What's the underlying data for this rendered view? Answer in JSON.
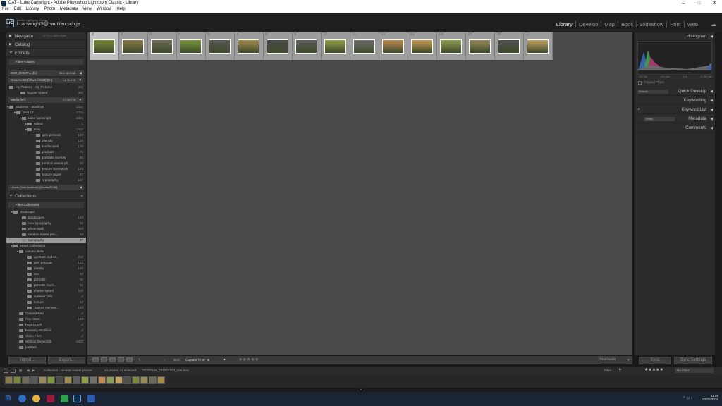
{
  "window": {
    "title": "CAT - Luke Cartwright - Adobe Photoshop Lightroom Classic - Library"
  },
  "menu": [
    "File",
    "Edit",
    "Library",
    "Photo",
    "Metadata",
    "View",
    "Window",
    "Help"
  ],
  "identity": {
    "app": "Adobe Lightroom Classic",
    "user": "l.cartwright5@hautlieu.sch.je"
  },
  "modules": [
    "Library",
    "Develop",
    "Map",
    "Book",
    "Slideshow",
    "Print",
    "Web"
  ],
  "active_module": "Library",
  "left": {
    "navigator": {
      "label": "Navigator",
      "opts": "FIT  FILL  100%  300%"
    },
    "catalog": "Catalog",
    "folders": "Folders",
    "filter_folders": "Filter Folders",
    "volumes": [
      {
        "name": "EOS_DIGITAL (E:)",
        "info": "80.1 / 60.0 GB"
      },
      {
        "name": "Documents (\\\\fsvs1\\\\Sd$) (H:)",
        "info": "0.6 / 1.6 TB"
      }
    ],
    "folders_a": [
      {
        "name": "My Pictures - My Pictures",
        "count": "465",
        "indent": 4
      },
      {
        "name": "Shutter Speed",
        "count": "465",
        "indent": 20
      }
    ],
    "volume3": {
      "name": "Media (M:)",
      "info": "0.7 / 3.6 TB"
    },
    "folders_b": [
      {
        "name": "Students - Students",
        "count": "1334",
        "indent": 4,
        "tri": "▾"
      },
      {
        "name": "Year 12",
        "count": "1334",
        "indent": 14,
        "tri": "▾"
      },
      {
        "name": "Luke Cartwright",
        "count": "1334",
        "indent": 22,
        "tri": "▾"
      },
      {
        "name": "edited",
        "count": "1",
        "indent": 30,
        "tri": "▸"
      },
      {
        "name": "Raw",
        "count": "1333",
        "indent": 30,
        "tri": "▾"
      },
      {
        "name": "gels portraits",
        "count": "123",
        "indent": 42,
        "tri": ""
      },
      {
        "name": "identity",
        "count": "128",
        "indent": 42,
        "tri": ""
      },
      {
        "name": "landscapes",
        "count": "176",
        "indent": 42,
        "tri": ""
      },
      {
        "name": "portraits",
        "count": "76",
        "indent": 42,
        "tri": ""
      },
      {
        "name": "portraits low-key",
        "count": "85",
        "indent": 42,
        "tri": ""
      },
      {
        "name": "random easter ph...",
        "count": "34",
        "indent": 42,
        "tri": ""
      },
      {
        "name": "texture homework",
        "count": "124",
        "indent": 42,
        "tri": ""
      },
      {
        "name": "texture paper",
        "count": "87",
        "indent": 42,
        "tri": ""
      },
      {
        "name": "typography",
        "count": "107",
        "indent": 42,
        "tri": ""
      }
    ],
    "volume4": "Ubuntu (\\\\wsl.localhost) (Ubuntu-22.04)",
    "collections": "Collections",
    "filter_collections": "Filter Collections",
    "coll": [
      {
        "name": "landscape",
        "count": "",
        "indent": 10,
        "tri": "▾"
      },
      {
        "name": "landscapes",
        "count": "124",
        "indent": 22,
        "tri": ""
      },
      {
        "name": "new typography",
        "count": "98",
        "indent": 22,
        "tri": ""
      },
      {
        "name": "photo walk",
        "count": "463",
        "indent": 22,
        "tri": ""
      },
      {
        "name": "random easter pho...",
        "count": "34",
        "indent": 22,
        "tri": ""
      },
      {
        "name": "typography",
        "count": "37",
        "indent": 22,
        "tri": "",
        "sel": true
      },
      {
        "name": "Smart Collections",
        "count": "",
        "indent": 10,
        "tri": "▾"
      },
      {
        "name": "comms skills",
        "count": "",
        "indent": 18,
        "tri": "▾"
      },
      {
        "name": "aperture and D...",
        "count": "228",
        "indent": 30,
        "tri": ""
      },
      {
        "name": "gels portraits",
        "count": "123",
        "indent": 30,
        "tri": ""
      },
      {
        "name": "identity",
        "count": "128",
        "indent": 30,
        "tri": ""
      },
      {
        "name": "ISO",
        "count": "44",
        "indent": 30,
        "tri": ""
      },
      {
        "name": "portraits",
        "count": "75",
        "indent": 30,
        "tri": ""
      },
      {
        "name": "portraits low-k...",
        "count": "85",
        "indent": 30,
        "tri": ""
      },
      {
        "name": "shutter speed",
        "count": "119",
        "indent": 30,
        "tri": ""
      },
      {
        "name": "summer task",
        "count": "0",
        "indent": 30,
        "tri": ""
      },
      {
        "name": "texture",
        "count": "64",
        "indent": 30,
        "tri": ""
      },
      {
        "name": "Texture Homew...",
        "count": "124",
        "indent": 30,
        "tri": ""
      },
      {
        "name": "Colored Red",
        "count": "0",
        "indent": 18,
        "tri": ""
      },
      {
        "name": "Five Stars",
        "count": "123",
        "indent": 18,
        "tri": ""
      },
      {
        "name": "Past Month",
        "count": "0",
        "indent": 18,
        "tri": ""
      },
      {
        "name": "Recently Modified",
        "count": "0",
        "indent": 18,
        "tri": ""
      },
      {
        "name": "Video Files",
        "count": "0",
        "indent": 18,
        "tri": ""
      },
      {
        "name": "Without Keywords",
        "count": "1603",
        "indent": 18,
        "tri": ""
      },
      {
        "name": "portraits",
        "count": "",
        "indent": 18,
        "tri": ""
      }
    ],
    "import": "Import...",
    "export": "Export..."
  },
  "grid": {
    "numbers": [
      "1",
      "2",
      "3",
      "4",
      "5",
      "6",
      "7",
      "8",
      "9",
      "10",
      "11",
      "12",
      "13",
      "14",
      "15",
      "16",
      "17"
    ],
    "colors": [
      "#7a8a3a",
      "#8c7b4a",
      "#6e6b55",
      "#7c9a3e",
      "#585858",
      "#a48a4c",
      "#4a4a4a",
      "#5e5e5e",
      "#93a04a",
      "#707070",
      "#c08a50",
      "#c89a52",
      "#8aa050",
      "#9a8a5a",
      "#4f4f4f",
      "#c4a460"
    ]
  },
  "toolbar": {
    "sort_label": "Sort:",
    "sort_value": "Capture Time",
    "stars": "★★★★★",
    "thumbnails": "Thumbnails"
  },
  "right": {
    "histogram": "Histogram",
    "hist_values": [
      "ISO 100",
      "4.00 mm",
      "f/1.8",
      "1/1,300 sec"
    ],
    "original_photo": "Original Photo",
    "panels": [
      "Quick Develop",
      "Keyword List",
      "Metadata",
      "Comments"
    ],
    "keywording": "Keywording",
    "qd_preset": "Defaults",
    "meta_preset": "Default",
    "sync": "Sync",
    "sync_settings": "Sync Settings"
  },
  "filmbar": {
    "pages": "1   2",
    "source": "Collection : random easter photos",
    "count": "34 photos / 1 selected",
    "file": "/20250416_161804913_iOS.heic",
    "filter_label": "Filter :",
    "filter_value": "No Filter"
  },
  "filmstrip": {
    "colors": [
      "#8a7a4a",
      "#7a8a3a",
      "#6e6b55",
      "#585858",
      "#9a8a5a",
      "#7c9a3e",
      "#4a4a4a",
      "#a48a4c",
      "#5e5e5e",
      "#93a04a",
      "#707070",
      "#c08a50",
      "#8aa050",
      "#c4a460",
      "#4f4f4f",
      "#7a8a3a",
      "#9a8a5a",
      "#6e6b55",
      "#a48a4c"
    ]
  },
  "taskbar": {
    "time": "11:08",
    "date": "23/05/2025"
  }
}
